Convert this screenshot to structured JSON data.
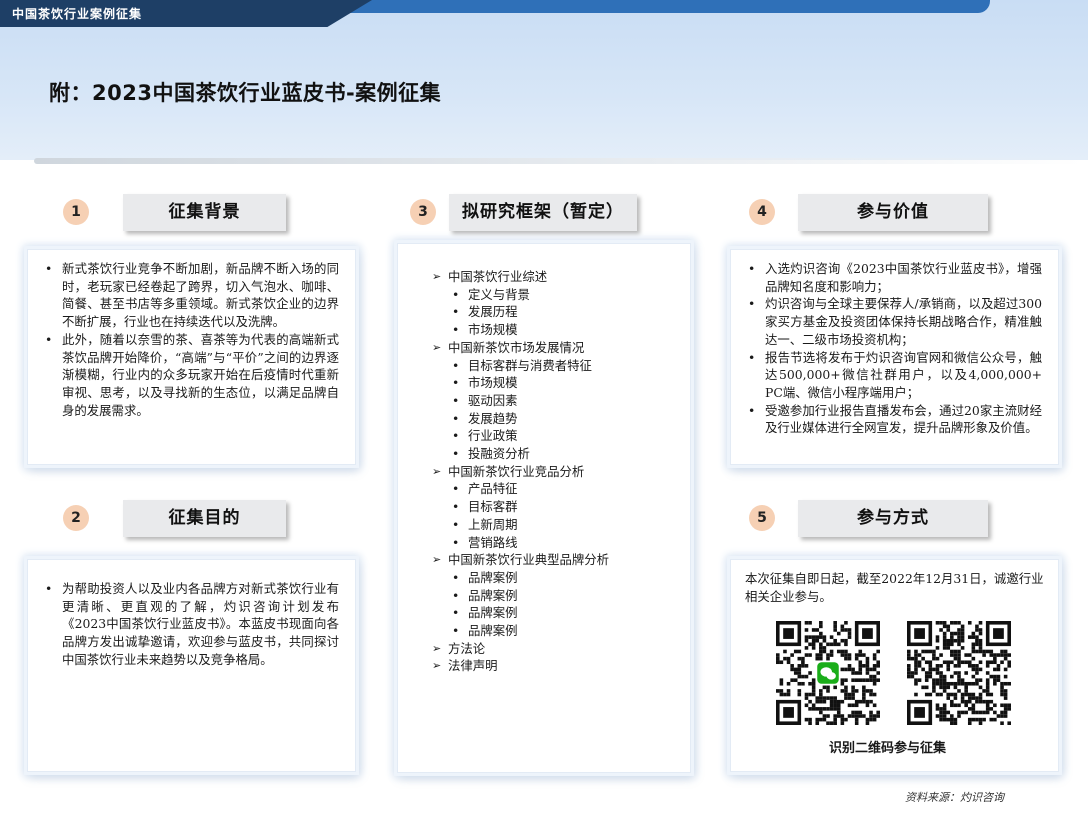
{
  "header": {
    "tab_text": "中国茶饮行业案例征集",
    "title": "附：2023中国茶饮行业蓝皮书-案例征集"
  },
  "sections": [
    {
      "num": "1",
      "title": "征集背景"
    },
    {
      "num": "2",
      "title": "征集目的"
    },
    {
      "num": "3",
      "title": "拟研究框架（暂定）"
    },
    {
      "num": "4",
      "title": "参与价值"
    },
    {
      "num": "5",
      "title": "参与方式"
    }
  ],
  "background": {
    "bullets": [
      "新式茶饮行业竞争不断加剧，新品牌不断入场的同时，老玩家已经卷起了跨界，切入气泡水、咖啡、简餐、甚至书店等多重领域。新式茶饮企业的边界不断扩展，行业也在持续迭代以及洗牌。",
      "此外，随着以奈雪的茶、喜茶等为代表的高端新式茶饮品牌开始降价，“高端”与“平价”之间的边界逐渐模糊，行业内的众多玩家开始在后疫情时代重新审视、思考，以及寻找新的生态位，以满足品牌自身的发展需求。"
    ]
  },
  "purpose": {
    "bullets": [
      "为帮助投资人以及业内各品牌方对新式茶饮行业有更清晰、更直观的了解，灼识咨询计划发布《2023中国茶饮行业蓝皮书》。本蓝皮书现面向各品牌方发出诚挚邀请，欢迎参与蓝皮书，共同探讨中国茶饮行业未来趋势以及竞争格局。"
    ]
  },
  "framework": {
    "items": [
      {
        "level": 1,
        "text": "中国茶饮行业综述"
      },
      {
        "level": 2,
        "text": "定义与背景"
      },
      {
        "level": 2,
        "text": "发展历程"
      },
      {
        "level": 2,
        "text": "市场规模"
      },
      {
        "level": 1,
        "text": "中国新茶饮市场发展情况"
      },
      {
        "level": 2,
        "text": "目标客群与消费者特征"
      },
      {
        "level": 2,
        "text": "市场规模"
      },
      {
        "level": 2,
        "text": "驱动因素"
      },
      {
        "level": 2,
        "text": "发展趋势"
      },
      {
        "level": 2,
        "text": "行业政策"
      },
      {
        "level": 2,
        "text": "投融资分析"
      },
      {
        "level": 1,
        "text": "中国新茶饮行业竞品分析"
      },
      {
        "level": 2,
        "text": "产品特征"
      },
      {
        "level": 2,
        "text": "目标客群"
      },
      {
        "level": 2,
        "text": "上新周期"
      },
      {
        "level": 2,
        "text": "营销路线"
      },
      {
        "level": 1,
        "text": "中国新茶饮行业典型品牌分析"
      },
      {
        "level": 2,
        "text": "品牌案例"
      },
      {
        "level": 2,
        "text": "品牌案例"
      },
      {
        "level": 2,
        "text": "品牌案例"
      },
      {
        "level": 2,
        "text": "品牌案例"
      },
      {
        "level": 1,
        "text": "方法论"
      },
      {
        "level": 1,
        "text": "法律声明"
      }
    ]
  },
  "value": {
    "bullets": [
      "入选灼识咨询《2023中国茶饮行业蓝皮书》，增强品牌知名度和影响力；",
      "灼识咨询与全球主要保荐人/承销商，以及超过300家买方基金及投资团体保持长期战略合作，精准触达一、二级市场投资机构；",
      "报告节选将发布于灼识咨询官网和微信公众号，触达500,000+微信社群用户，以及4,000,000+ PC端、微信小程序端用户；",
      "受邀参加行业报告直播发布会，通过20家主流财经及行业媒体进行全网宣发，提升品牌形象及价值。"
    ]
  },
  "method": {
    "text": "本次征集自即日起，截至2022年12月31日，诚邀行业相关企业参与。",
    "qr_label": "识别二维码参与征集",
    "qr_icons": [
      "wechat-qr-code-icon",
      "mini-program-qr-code-icon"
    ]
  },
  "footer": {
    "source": "资料来源：灼识咨询"
  },
  "colors": {
    "header_dark": "#1e3f66",
    "header_stripe": "#2f70b8",
    "number_circle": "#f6d0b4",
    "tag_bg": "#e9eaec",
    "wechat_green": "#1aad19"
  }
}
